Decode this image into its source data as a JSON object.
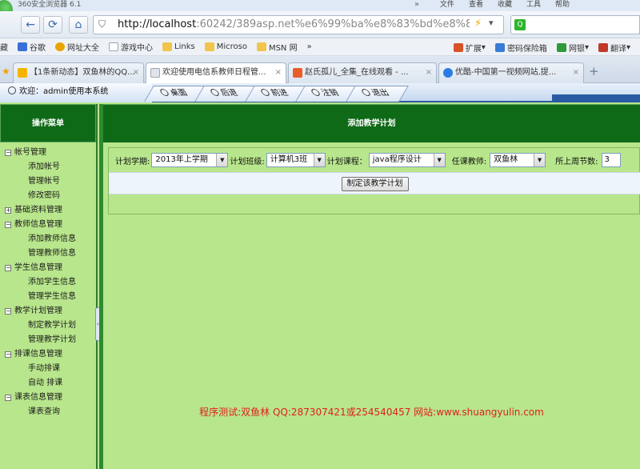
{
  "browser": {
    "window_title": "360安全浏览器 6.1",
    "top_menus": [
      "文件",
      "查看",
      "收藏",
      "工具",
      "帮助"
    ],
    "url_host": "http://localhost",
    "url_rest": ":60242/389asp.net%e6%99%ba%e8%83%bd%e8%87%",
    "bookmarks_label": "藏",
    "bookmarks": [
      {
        "label": "谷歌",
        "icon": "google-icon",
        "color": "#3b6fd8"
      },
      {
        "label": "网址大全",
        "icon": "star-icon",
        "color": "#e8a500"
      },
      {
        "label": "游戏中心",
        "icon": "page-icon",
        "color": "#cfd7e2"
      },
      {
        "label": "Links",
        "icon": "folder-icon",
        "color": "#f1c54b"
      },
      {
        "label": "Microso",
        "icon": "folder-icon",
        "color": "#f1c54b"
      },
      {
        "label": "MSN 网",
        "icon": "folder-icon",
        "color": "#f1c54b"
      }
    ],
    "bookmarks_more": "»",
    "bookmarks_right": [
      {
        "label": "扩展",
        "icon": "grid-icon",
        "color": "#d9522a"
      },
      {
        "label": "密码保险箱",
        "icon": "key-icon",
        "color": "#3a7bd5"
      },
      {
        "label": "网银",
        "icon": "shield-icon",
        "color": "#2e9a3a"
      },
      {
        "label": "翻译",
        "icon": "translate-icon",
        "color": "#c0392b"
      }
    ],
    "tabs": [
      {
        "label": "【1条新动态】双鱼林的QQ...",
        "color": "#f5b400",
        "active": false
      },
      {
        "label": "欢迎使用电信系教师日程管...",
        "color": "#dfe4ea",
        "active": true
      },
      {
        "label": "赵氏孤儿_全集_在线观看 - ...",
        "color": "#e85d2a",
        "active": false
      },
      {
        "label": "优酷-中国第一视频网站,提...",
        "color": "#2c7be5",
        "active": false
      }
    ]
  },
  "app": {
    "welcome": "欢迎：admin使用本系统",
    "nav_tabs": [
      "桌面",
      "后退",
      "前进",
      "注销",
      "退出"
    ],
    "sidebar_title": "操作菜单",
    "tree": [
      {
        "label": "帐号管理",
        "expanded": true,
        "children": [
          "添加帐号",
          "管理帐号",
          "修改密码"
        ]
      },
      {
        "label": "基础资料管理",
        "expanded": false,
        "children": []
      },
      {
        "label": "教师信息管理",
        "expanded": true,
        "children": [
          "添加教师信息",
          "管理教师信息"
        ]
      },
      {
        "label": "学生信息管理",
        "expanded": true,
        "children": [
          "添加学生信息",
          "管理学生信息"
        ]
      },
      {
        "label": "教学计划管理",
        "expanded": true,
        "children": [
          "制定教学计划",
          "管理教学计划"
        ]
      },
      {
        "label": "排课信息管理",
        "expanded": true,
        "children": [
          "手动排课",
          "自动 排课"
        ]
      },
      {
        "label": "课表信息管理",
        "expanded": true,
        "children": [
          "课表查询"
        ]
      }
    ],
    "main_title": "添加教学计划",
    "form": {
      "term_label": "计划学期:",
      "term_value": "2013年上学期",
      "class_label": "计划班级:",
      "class_value": "计算机3班",
      "course_label": "计划课程：",
      "course_value": "java程序设计",
      "teacher_label": "任课教师:",
      "teacher_value": "双鱼林",
      "hours_label": "所上周节数:",
      "hours_value": "3",
      "submit_label": "制定该教学计划"
    },
    "footer": "程序测试:双鱼林 QQ:287307421或254540457 网站:www.shuangyulin.com",
    "colors": {
      "header_green": "#0f6a18",
      "page_green": "#b8e68c",
      "footer_red": "#e0201a"
    }
  }
}
